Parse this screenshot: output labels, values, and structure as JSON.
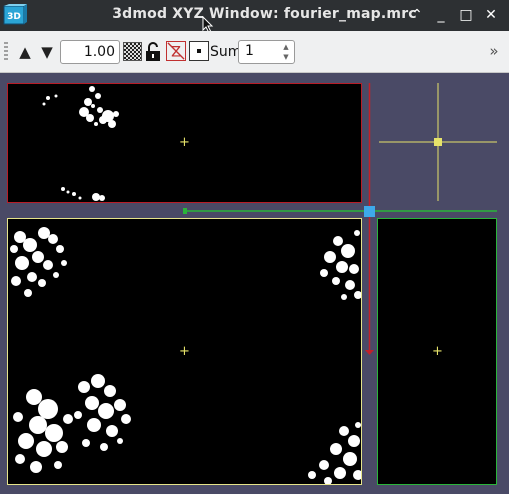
{
  "window": {
    "title": "3dmod XYZ Window: fourier_map.mrc",
    "buttons": {
      "shade": "⌃",
      "minimize": "_",
      "maximize": "□",
      "close": "✕"
    }
  },
  "toolbar": {
    "step_up": "▲",
    "step_down": "▼",
    "zoom_value": "1.00",
    "z_label": "Z",
    "sum_label": "Sum",
    "sum_value": "1",
    "more": "»"
  },
  "colors": {
    "xz_border": "#b81d27",
    "xy_border": "#e6e48a",
    "yz_border": "#2ab53a",
    "crosshair": "#e6e36a",
    "z_slider": "#3ea9ea",
    "background": "#4a4a66"
  },
  "icons": [
    "app-icon",
    "cursor-icon",
    "checker-icon",
    "lock-icon",
    "z-toggle-icon",
    "dot-icon",
    "spin-up-icon",
    "spin-down-icon",
    "overflow-icon"
  ]
}
